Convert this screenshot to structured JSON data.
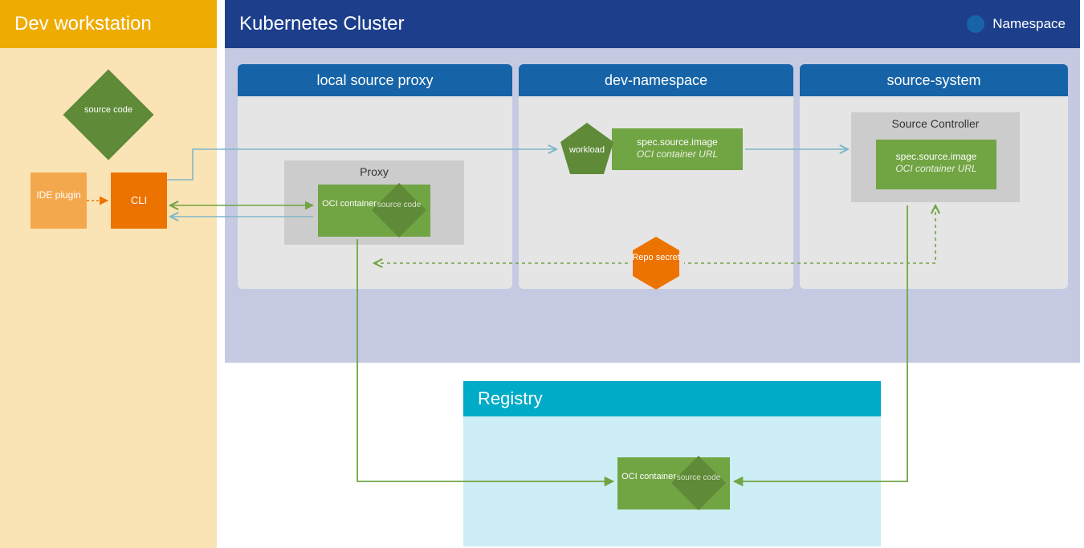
{
  "dev": {
    "title": "Dev workstation",
    "source_code": "source code",
    "ide_plugin": "IDE plugin",
    "cli": "CLI"
  },
  "cluster": {
    "title": "Kubernetes Cluster",
    "legend": "Namespace",
    "ns_proxy": {
      "title": "local source proxy",
      "proxy_label": "Proxy",
      "oci": "OCI container",
      "source_code": "source code"
    },
    "ns_dev": {
      "title": "dev-namespace",
      "workload": "workload",
      "spec_line1": "spec.source.image",
      "spec_line2": "OCI container URL",
      "repo_secret": "Repo secret"
    },
    "ns_source": {
      "title": "source-system",
      "controller": "Source Controller",
      "spec_line1": "spec.source.image",
      "spec_line2": "OCI container URL"
    }
  },
  "registry": {
    "title": "Registry",
    "oci": "OCI container",
    "source_code": "source code"
  },
  "colors": {
    "gold": "#eeab00",
    "gold_light": "#fae4b5",
    "navy": "#1d3f8b",
    "lavender": "#c5cae2",
    "pane_blue": "#1664a7",
    "pane_gray": "#e5e5e5",
    "light_gray": "#cccccc",
    "green": "#71a443",
    "green_dark": "#5f8a38",
    "orange": "#ed7300",
    "orange_light": "#f4a84e",
    "teal": "#00abc7",
    "teal_light": "#cceef4",
    "arrow_teal": "#7fb7c9",
    "arrow_green": "#71a443",
    "arrow_orange": "#ed7300"
  }
}
